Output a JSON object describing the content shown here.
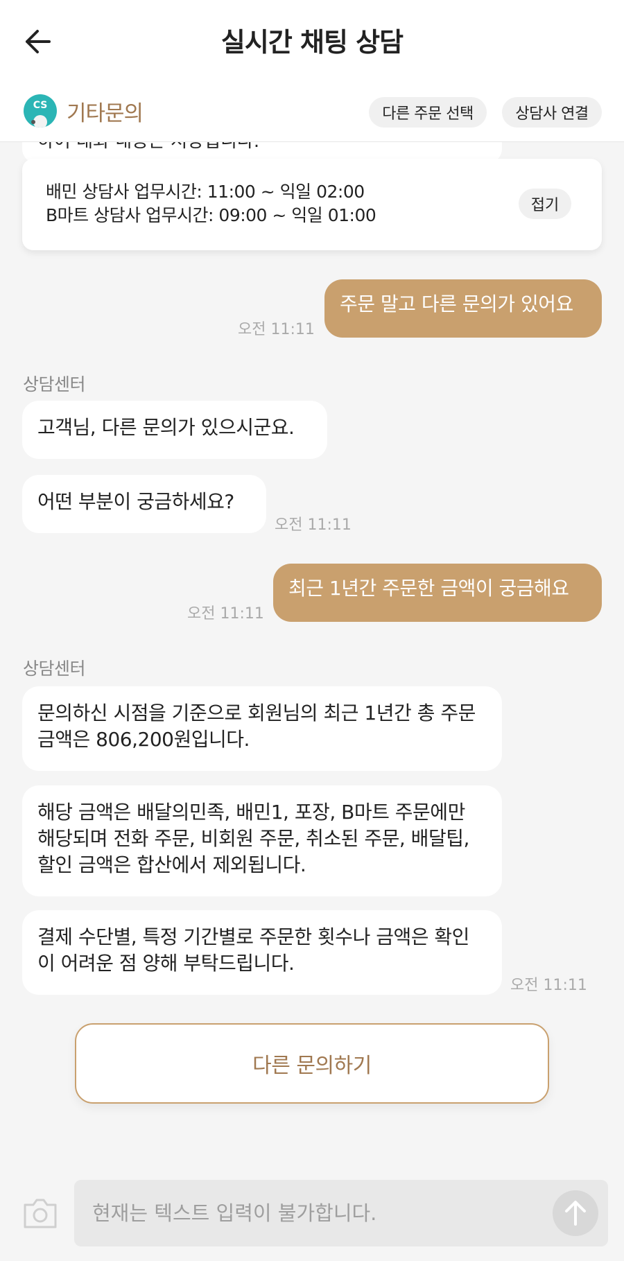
{
  "header": {
    "title": "실시간 채팅 상담"
  },
  "subbar": {
    "avatar_text": "CS",
    "category": "기타문의",
    "chip_select_order": "다른 주문 선택",
    "chip_connect_agent": "상담사 연결"
  },
  "notice": {
    "cut_text": "하여 대화 내용은 저장됩니다.",
    "hours_line_1": "배민 상담사 업무시간: 11:00 ~ 익일 02:00",
    "hours_line_2": "B마트 상담사 업무시간: 09:00 ~ 익일 01:00",
    "fold_label": "접기"
  },
  "messages": {
    "user_1": "주문 말고 다른 문의가 있어요",
    "user_1_time": "오전 11:11",
    "sender_1": "상담센터",
    "bot_1": "고객님, 다른 문의가 있으시군요.",
    "bot_2": "어떤 부분이 궁금하세요?",
    "bot_2_time": "오전 11:11",
    "user_2": "최근 1년간 주문한 금액이 궁금해요",
    "user_2_time": "오전 11:11",
    "sender_2": "상담센터",
    "bot_3": "문의하신 시점을 기준으로 회원님의 최근 1년간 총 주문금액은 806,200원입니다.",
    "bot_4": "해당 금액은 배달의민족, 배민1, 포장, B마트 주문에만 해당되며 전화 주문, 비회원 주문, 취소된 주문, 배달팁, 할인 금액은 합산에서 제외됩니다.",
    "bot_5": "결제 수단별, 특정 기간별로 주문한 횟수나 금액은 확인이 어려운 점 양해 부탁드립니다.",
    "bot_5_time": "오전 11:11"
  },
  "actions": {
    "other_inquiry": "다른 문의하기"
  },
  "input": {
    "placeholder": "현재는 텍스트 입력이 불가합니다."
  },
  "colors": {
    "accent": "#c9a06e",
    "accent_text": "#a07850",
    "avatar": "#2bb5b5"
  },
  "icons": {
    "back": "arrow-left-icon",
    "camera": "camera-icon",
    "send": "arrow-up-icon"
  }
}
